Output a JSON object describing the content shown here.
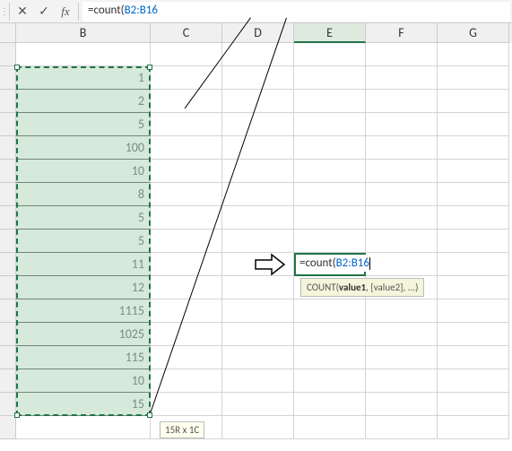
{
  "formula_bar": {
    "fx_label": "fx",
    "formula_text_pre": "=count(",
    "formula_text_ref": "B2:B16"
  },
  "columns": [
    "B",
    "C",
    "D",
    "E",
    "F",
    "G"
  ],
  "selection": {
    "range_label": "15R x 1C",
    "values": [
      "1",
      "2",
      "5",
      "100",
      "10",
      "8",
      "5",
      "5",
      "11",
      "12",
      "1115",
      "1025",
      "115",
      "10",
      "15"
    ]
  },
  "active_cell": {
    "formula_pre": "=count(",
    "formula_ref": "B2:B16"
  },
  "tooltip": {
    "fn": "COUNT",
    "arg1": "value1",
    "rest": ", [value2], ...)"
  },
  "x_glyph": "✕",
  "check_glyph": "✓"
}
